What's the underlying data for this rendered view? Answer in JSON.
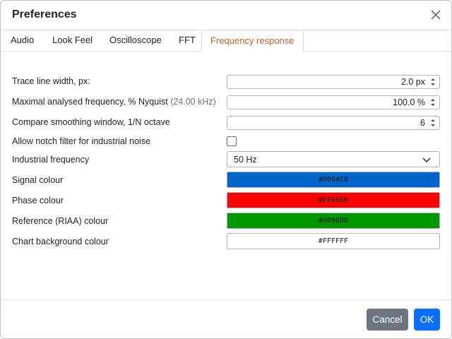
{
  "dialog": {
    "title": "Preferences"
  },
  "tabs": [
    {
      "label": "Audio",
      "active": false
    },
    {
      "label": "Look Feel",
      "active": false
    },
    {
      "label": "Oscilloscope",
      "active": false
    },
    {
      "label": "FFT",
      "active": false
    },
    {
      "label": "Frequency response",
      "active": true
    }
  ],
  "settings": {
    "trace_width": {
      "label": "Trace line width, px:",
      "value": "2.0 px"
    },
    "max_freq": {
      "label": "Maximal analysed frequency, % Nyquist",
      "hint": "(24.00 kHz)",
      "value": "100.0 %"
    },
    "smoothing": {
      "label": "Compare smoothing window, 1/N octave",
      "value": "6"
    },
    "notch": {
      "label": "Allow notch filter for industrial noise",
      "checked": false
    },
    "industrial_freq": {
      "label": "Industrial frequency",
      "value": "50 Hz"
    },
    "signal_colour": {
      "label": "Signal colour",
      "value": "#0064C8",
      "bg": "#0064C8"
    },
    "phase_colour": {
      "label": "Phase colour",
      "value": "#FF0000",
      "bg": "#FF0000"
    },
    "reference_colour": {
      "label": "Reference (RIAA) colour",
      "value": "#009600",
      "bg": "#009600"
    },
    "background_colour": {
      "label": "Chart background colour",
      "value": "#FFFFFF",
      "bg": "#FFFFFF"
    }
  },
  "footer": {
    "cancel_label": "Cancel",
    "ok_label": "OK"
  },
  "colors": {
    "active_tab_text": "#c0622d",
    "cancel_bg": "#6c757d",
    "ok_bg": "#0d6efd"
  },
  "icons": {
    "close": "close-icon",
    "spinner": "spinner-icon",
    "chevron": "chevron-down-icon"
  }
}
